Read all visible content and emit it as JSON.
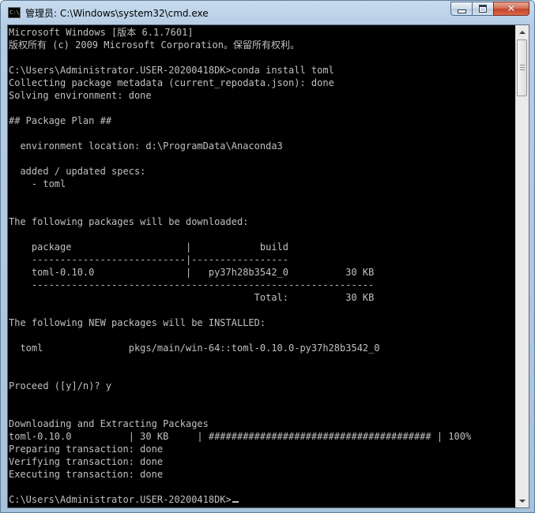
{
  "window": {
    "title": "管理员: C:\\Windows\\system32\\cmd.exe",
    "app_icon": "cmd-icon",
    "controls": {
      "minimize": "minimize-icon",
      "maximize": "maximize-icon",
      "close": "close-icon"
    }
  },
  "console": {
    "lines": [
      "Microsoft Windows [版本 6.1.7601]",
      "版权所有 (c) 2009 Microsoft Corporation。保留所有权利。",
      "",
      "C:\\Users\\Administrator.USER-20200418DK>conda install toml",
      "Collecting package metadata (current_repodata.json): done",
      "Solving environment: done",
      "",
      "## Package Plan ##",
      "",
      "  environment location: d:\\ProgramData\\Anaconda3",
      "",
      "  added / updated specs:",
      "    - toml",
      "",
      "",
      "The following packages will be downloaded:",
      "",
      "    package                    |            build",
      "    ---------------------------|-----------------",
      "    toml-0.10.0                |   py37h28b3542_0          30 KB",
      "    ------------------------------------------------------------",
      "                                           Total:          30 KB",
      "",
      "The following NEW packages will be INSTALLED:",
      "",
      "  toml               pkgs/main/win-64::toml-0.10.0-py37h28b3542_0",
      "",
      "",
      "Proceed ([y]/n)? y",
      "",
      "",
      "Downloading and Extracting Packages",
      "toml-0.10.0          | 30 KB     | ####################################### | 100%",
      "Preparing transaction: done",
      "Verifying transaction: done",
      "Executing transaction: done",
      "",
      "C:\\Users\\Administrator.USER-20200418DK>"
    ],
    "text_color": "#c0c0c0",
    "background_color": "#000000"
  },
  "scrollbar": {
    "up_icon": "scroll-up-arrow-icon",
    "down_icon": "scroll-down-arrow-icon"
  }
}
